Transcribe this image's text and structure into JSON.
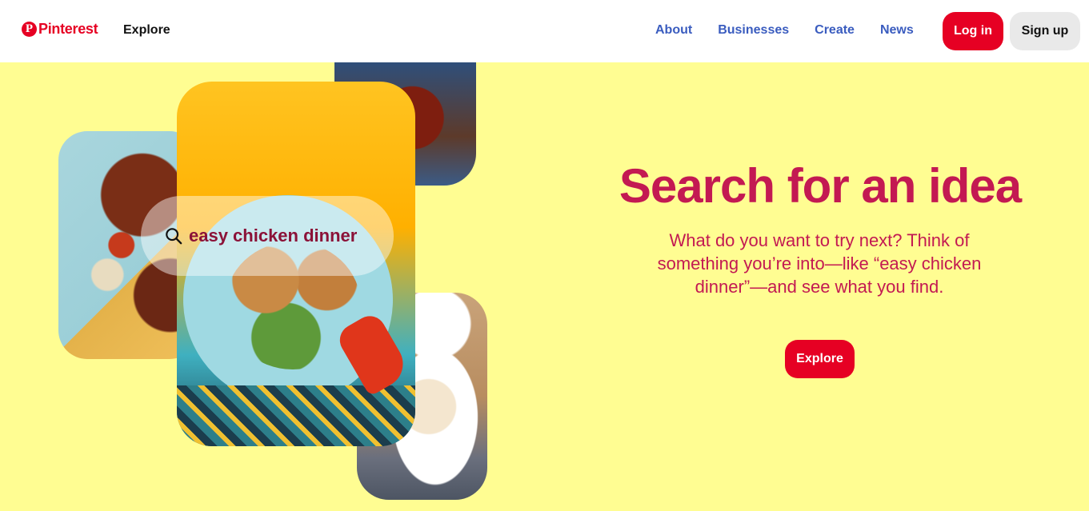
{
  "header": {
    "logo_text": "Pinterest",
    "logo_mark": "P",
    "explore_label": "Explore",
    "nav": [
      "About",
      "Businesses",
      "Create",
      "News"
    ],
    "login_label": "Log in",
    "signup_label": "Sign up"
  },
  "collage": {
    "search_query": "easy chicken dinner",
    "search_icon": "search-icon"
  },
  "hero": {
    "title": "Search for an idea",
    "description": "What do you want to try next? Think of something you’re into—like “easy chicken dinner”—and see what you find.",
    "explore_label": "Explore"
  },
  "colors": {
    "background": "#fffd92",
    "brand_red": "#e60023",
    "heading": "#c31952",
    "nav_link": "#3a5cbf"
  }
}
